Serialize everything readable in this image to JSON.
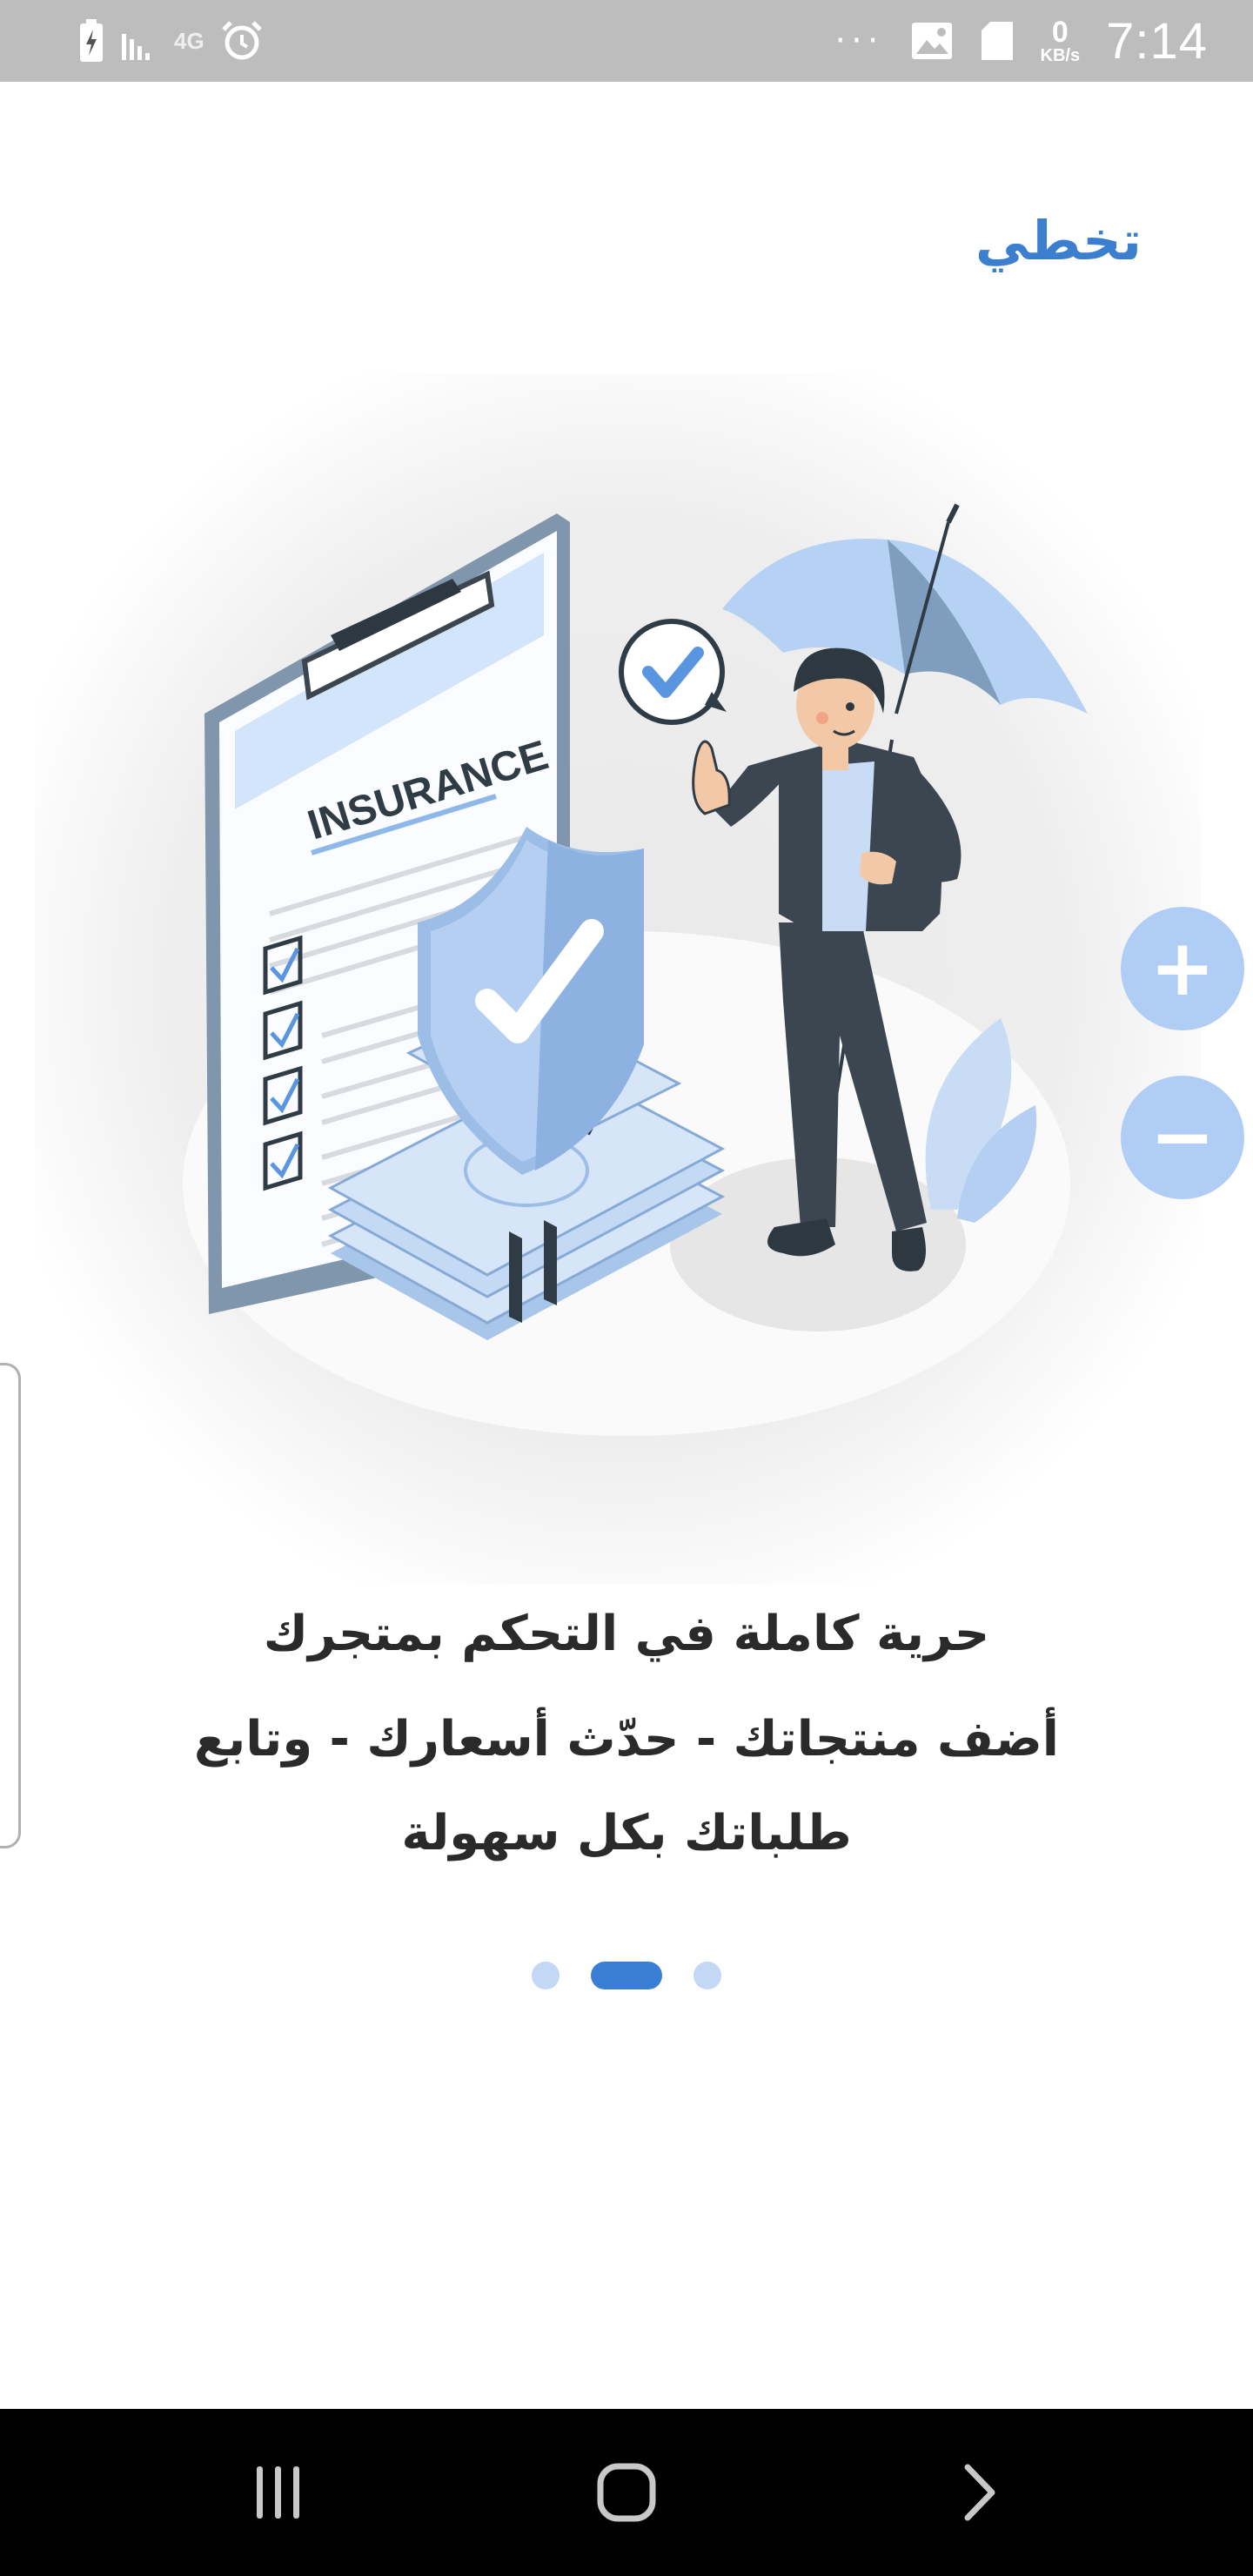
{
  "status_bar": {
    "time": "7:14",
    "net_speed_value": "0",
    "net_speed_unit": "KB/s",
    "overflow": "···",
    "network_label": "4G"
  },
  "skip_label": "تخطي",
  "onboarding": {
    "title": "حرية كاملة في التحكم بمتجرك",
    "description": "أضف منتجاتك - حدّث أسعارك - وتابع طلباتك بكل سهولة",
    "page_count": 3,
    "current_page": 2
  },
  "illustration": {
    "heading": "INSURANCE"
  },
  "zoom": {
    "in_label": "+",
    "out_label": "−"
  },
  "colors": {
    "accent": "#3a7fd4",
    "skip_text": "#3d7fcf",
    "zoom_button": "#b0cdf6",
    "dot_inactive": "#c2d8f4",
    "status_bar": "#bdbdbd",
    "nav_bar": "#000000"
  }
}
